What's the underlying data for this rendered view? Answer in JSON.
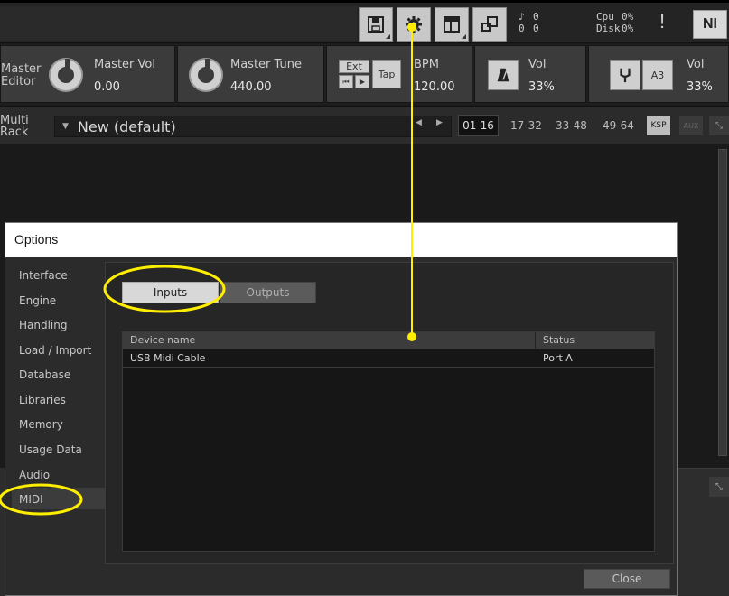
{
  "toolbar": {
    "meters": {
      "voices_icon": "♪",
      "voices": "0",
      "memory": "0",
      "row2_a": "0",
      "row2_b": "0",
      "cpu_label": "Cpu",
      "cpu_value": "0%",
      "disk_label": "Disk",
      "disk_value": "0%"
    },
    "warning_symbol": "!",
    "logo_text": "NI"
  },
  "master": {
    "editor_label_line1": "Master",
    "editor_label_line2": "Editor",
    "vol_label": "Master Vol",
    "vol_value": "0.00",
    "tune_label": "Master Tune",
    "tune_value": "440.00",
    "ext_label": "Ext",
    "tap_label": "Tap",
    "bpm_label": "BPM",
    "bpm_value": "120.00",
    "metronome_vol_label": "Vol",
    "metronome_vol_value": "33%",
    "tuner_note": "A3",
    "tuner_vol_label": "Vol",
    "tuner_vol_value": "33%"
  },
  "rack": {
    "label_line1": "Multi",
    "label_line2": "Rack",
    "preset_name": "New (default)",
    "pages": [
      "01-16",
      "17-32",
      "33-48",
      "49-64"
    ],
    "active_page": "01-16",
    "ksp_label": "KSP",
    "aux_label": "AUX"
  },
  "dialog": {
    "title": "Options",
    "nav": [
      "Interface",
      "Engine",
      "Handling",
      "Load / Import",
      "Database",
      "Libraries",
      "Memory",
      "Usage Data",
      "Audio",
      "MIDI"
    ],
    "active_nav": "MIDI",
    "tabs": [
      "Inputs",
      "Outputs"
    ],
    "active_tab": "Inputs",
    "table": {
      "columns": [
        "Device name",
        "Status"
      ],
      "rows": [
        {
          "device": "USB Midi Cable",
          "status": "Port A"
        }
      ]
    },
    "close_label": "Close"
  },
  "colors": {
    "annotation": "#ffee00",
    "background": "#1b1b1b",
    "panel": "#3b3b3b"
  }
}
